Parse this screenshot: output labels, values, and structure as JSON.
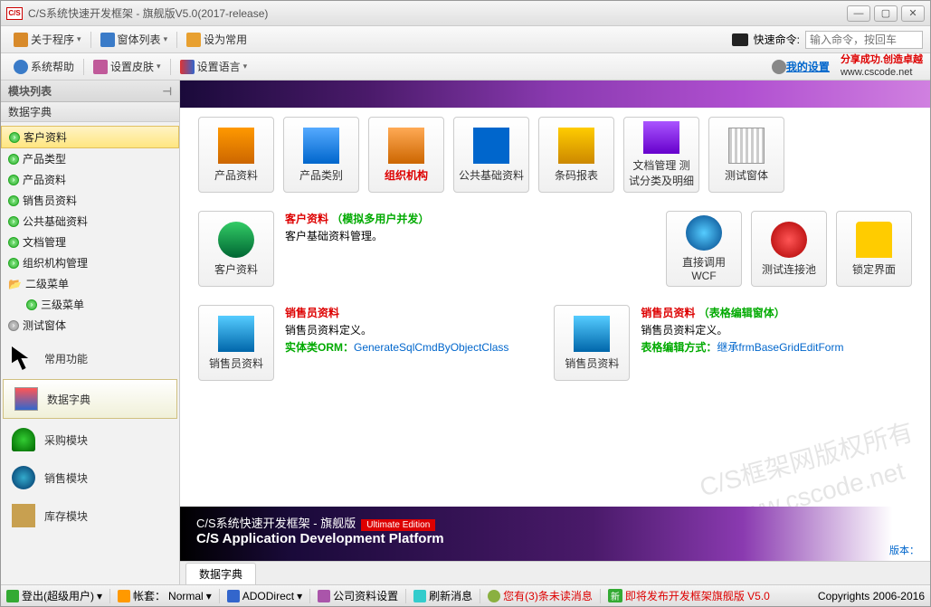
{
  "titlebar": {
    "title": "C/S系统快速开发框架 - 旗舰版V5.0(2017-release)"
  },
  "toolbar1": {
    "about": "关于程序",
    "windows": "窗体列表",
    "default": "设为常用",
    "quick_label": "快速命令:",
    "quick_placeholder": "输入命令，按回车"
  },
  "toolbar2": {
    "help": "系统帮助",
    "skin": "设置皮肤",
    "lang": "设置语言",
    "my_settings": "我的设置",
    "brand_red": "分享成功.创造卓越",
    "brand_url": "www.cscode.net"
  },
  "sidebar": {
    "header": "模块列表",
    "accordion": "数据字典",
    "tree": [
      {
        "label": "客户资料",
        "sel": true
      },
      {
        "label": "产品类型"
      },
      {
        "label": "产品资料"
      },
      {
        "label": "销售员资料"
      },
      {
        "label": "公共基础资料"
      },
      {
        "label": "文档管理"
      },
      {
        "label": "组织机构管理"
      },
      {
        "label": "二级菜单",
        "folder": true
      },
      {
        "label": "三级菜单",
        "child": true
      },
      {
        "label": "测试窗体",
        "grey": true
      }
    ],
    "tiles": [
      {
        "label": "常用功能",
        "ico": "ico-cursor"
      },
      {
        "label": "数据字典",
        "ico": "ico-dict",
        "sel": true
      },
      {
        "label": "采购模块",
        "ico": "ico-buy"
      },
      {
        "label": "销售模块",
        "ico": "ico-sale"
      },
      {
        "label": "库存模块",
        "ico": "ico-stock"
      }
    ]
  },
  "apps_row1": [
    {
      "label": "产品资料",
      "ico": "a-prod"
    },
    {
      "label": "产品类别",
      "ico": "a-cat"
    },
    {
      "label": "组织机构",
      "ico": "a-org",
      "red": true
    },
    {
      "label": "公共基础资料",
      "ico": "a-pub"
    },
    {
      "label": "条码报表",
      "ico": "a-bar"
    },
    {
      "label": "文档管理 测试分类及明细",
      "ico": "a-doc"
    },
    {
      "label": "测试窗体",
      "ico": "a-test"
    }
  ],
  "row2": {
    "cust_tile": "客户资料",
    "cust_title": "客户资料",
    "cust_note": "（模拟多用户并发）",
    "cust_desc": "客户基础资料管理。",
    "wcf": "直接调用WCF",
    "pool": "测试连接池",
    "lock": "锁定界面"
  },
  "row3": {
    "sales_tile": "销售员资料",
    "block1_title": "销售员资料",
    "block1_desc": "销售员资料定义。",
    "block1_orm_label": "实体类ORM：",
    "block1_orm_val": "GenerateSqlCmdByObjectClass",
    "block2_title": "销售员资料",
    "block2_note": "（表格编辑窗体）",
    "block2_desc": "销售员资料定义。",
    "block2_mode_label": "表格编辑方式：",
    "block2_mode_val": "继承frmBaseGridEditForm"
  },
  "watermark": {
    "l1": "C/S框架网版权所有",
    "l2": "www.cscode.net"
  },
  "footer": {
    "cn": "C/S系统快速开发框架 - 旗舰版",
    "badge": "Ultimate Edition",
    "en": "C/S Application Development Platform",
    "ver": "版本："
  },
  "tab": "数据字典",
  "status": {
    "login": "登出(超级用户)",
    "account_lbl": "帐套：",
    "account_val": "Normal",
    "conn": "ADODirect",
    "company": "公司资料设置",
    "refresh": "刷新消息",
    "unread": "您有(3)条未读消息",
    "release": "即将发布开发框架旗舰版 V5.0",
    "new": "新",
    "copyright": "Copyrights 2006-2016"
  }
}
